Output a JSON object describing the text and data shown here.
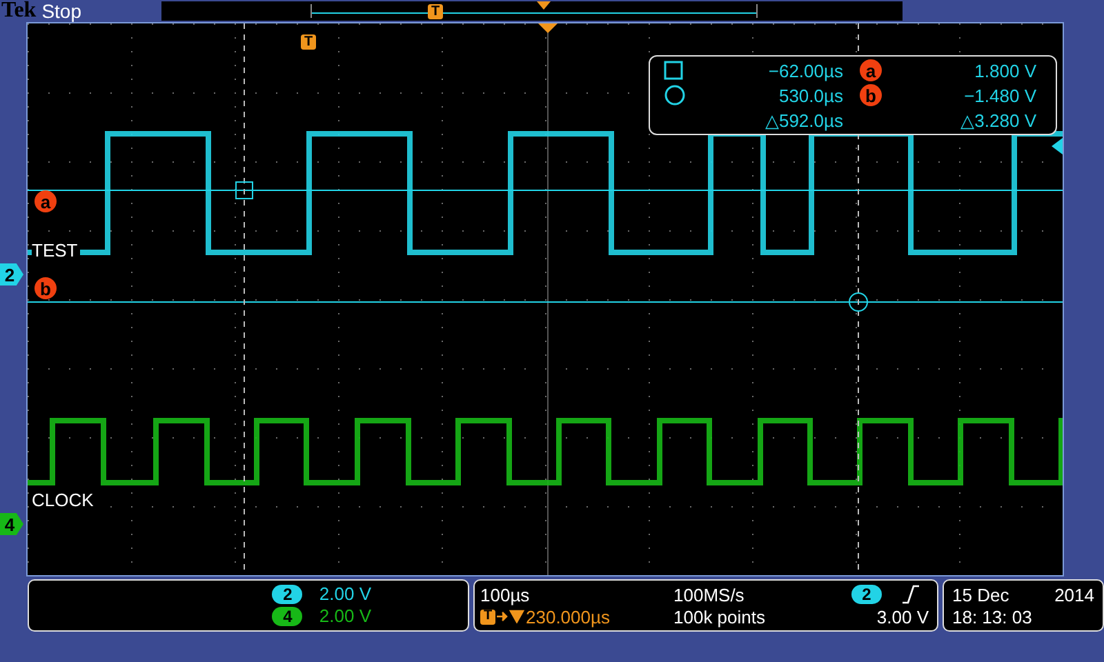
{
  "top_bar": {
    "brand": "Tek",
    "status": "Stop",
    "record_trigger_marker": "T"
  },
  "graticule": {
    "trigger_marker": "T"
  },
  "cursor_markers": [
    {
      "label": "a"
    },
    {
      "label": "b"
    }
  ],
  "channels": [
    {
      "marker": "2",
      "label": "TEST",
      "color": "#22d3e6",
      "readout_badge": "2",
      "scale": "2.00 V"
    },
    {
      "marker": "4",
      "label": "CLOCK",
      "color": "#17b817",
      "readout_badge": "4",
      "scale": "2.00 V"
    }
  ],
  "cursor_readout": {
    "time_1": "−62.00µs",
    "time_2": "530.0µs",
    "time_delta": "△592.0µs",
    "badge_a": "a",
    "badge_b": "b",
    "volt_a": "1.800 V",
    "volt_b": "−1.480 V",
    "volt_delta": "△3.280 V"
  },
  "horizontal": {
    "scale": "100µs",
    "trigger_marker": "T",
    "delay": "230.000µs",
    "sample_rate": "100MS/s",
    "record_length": "100k points"
  },
  "trigger": {
    "source": "2",
    "level": "3.00 V"
  },
  "clock": {
    "date": "15 Dec",
    "year": "2014",
    "time": "18: 13: 03"
  }
}
